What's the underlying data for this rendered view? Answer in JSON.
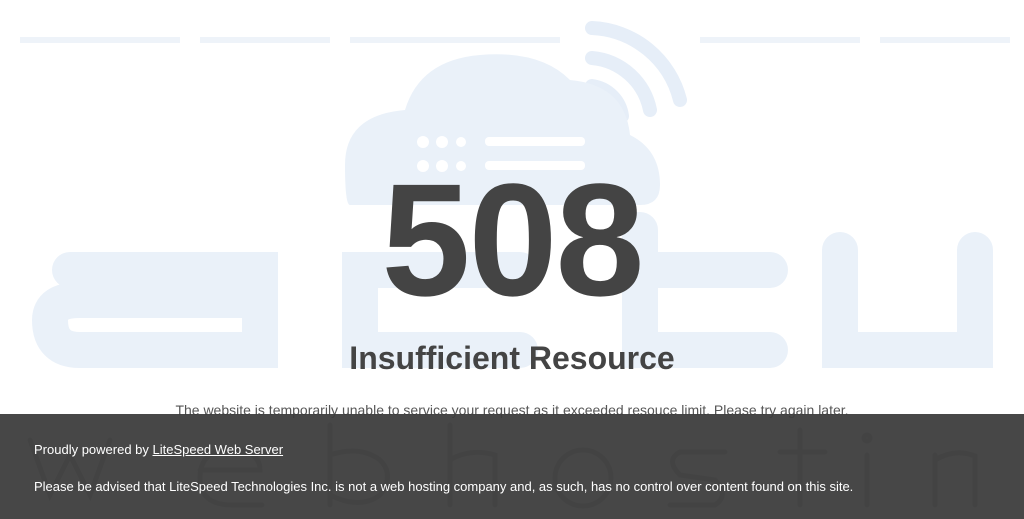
{
  "error": {
    "code": "508",
    "title": "Insufficient Resource",
    "message": "The website is temporarily unable to service your request as it exceeded resouce limit. Please try again later."
  },
  "footer": {
    "powered_prefix": "Proudly powered by ",
    "powered_link": "LiteSpeed Web Server",
    "disclaimer": "Please be advised that LiteSpeed Technologies Inc. is not a web hosting company and, as such, has no control over content found on this site."
  },
  "colors": {
    "text_dark": "#444444",
    "footer_bg": "#3c3c3c",
    "watermark": "#e8f0f8"
  },
  "icons": {
    "watermark": "cloud-wifi-logo-watermark"
  }
}
